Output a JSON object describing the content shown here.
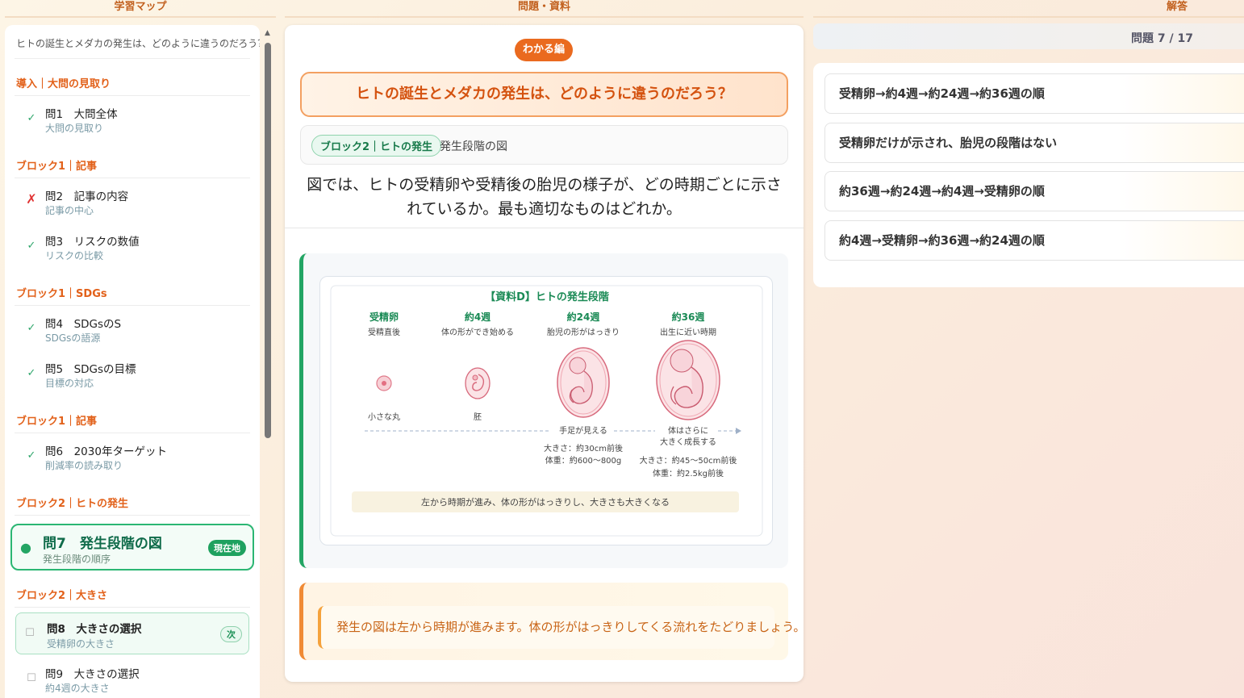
{
  "headers": {
    "map": "学習マップ",
    "problem": "問題・資料",
    "answer": "解答"
  },
  "sidebar": {
    "question": "ヒトの誕生とメダカの発生は、どのように違うのだろう？",
    "sections": [
      {
        "label": "導入｜大問の見取り",
        "items": [
          {
            "title": "問1　大問全体",
            "sub": "大問の見取り",
            "status": "✓"
          }
        ]
      },
      {
        "label": "ブロック1｜記事",
        "items": [
          {
            "title": "問2　記事の内容",
            "sub": "記事の中心",
            "status": "✗"
          },
          {
            "title": "問3　リスクの数値",
            "sub": "リスクの比較",
            "status": "✓"
          }
        ]
      },
      {
        "label": "ブロック1｜SDGs",
        "items": [
          {
            "title": "問4　SDGsのS",
            "sub": "SDGsの語源",
            "status": "✓"
          },
          {
            "title": "問5　SDGsの目標",
            "sub": "目標の対応",
            "status": "✓"
          }
        ]
      },
      {
        "label": "ブロック1｜記事",
        "items": [
          {
            "title": "問6　2030年ターゲット",
            "sub": "削減率の読み取り",
            "status": "✓"
          }
        ]
      },
      {
        "label": "ブロック2｜ヒトの発生",
        "items": [
          {
            "title": "問7　発生段階の図",
            "sub": "発生段階の順序",
            "status": "●",
            "badge": "現在地"
          }
        ]
      },
      {
        "label": "ブロック2｜大きさ",
        "items": [
          {
            "title": "問8　大きさの選択",
            "sub": "受精卵の大きさ",
            "status": "☐",
            "badge": "次"
          },
          {
            "title": "問9　大きさの選択",
            "sub": "約4週の大きさ",
            "status": "☐"
          }
        ]
      }
    ]
  },
  "main": {
    "level": "わかる編",
    "big_question": "ヒトの誕生とメダカの発生は、どのように違うのだろう？",
    "block_tag": "ブロック2｜ヒトの発生",
    "block_title": "発生段階の図",
    "question": "図では、ヒトの受精卵や受精後の胎児の様子が、どの時期ごとに示されているか。最も適切なものはどれか。",
    "figure": {
      "title": "【資料D】ヒトの発生段階",
      "stages": [
        {
          "name": "受精卵",
          "desc": "受精直後",
          "below": "小さな丸"
        },
        {
          "name": "約4週",
          "desc": "体の形ができ始める",
          "below": "胚"
        },
        {
          "name": "約24週",
          "desc": "胎児の形がはっきり",
          "below": "手足が見える"
        },
        {
          "name": "約36週",
          "desc": "出生に近い時期",
          "below": "体はさらに",
          "below2": "大きく成長する"
        }
      ],
      "size24": "大きさ：約30cm前後",
      "weight24": "体重：約600～800g",
      "size36": "大きさ：約45～50cm前後",
      "weight36": "体重：約2.5kg前後",
      "caption": "左から時期が進み、体の形がはっきりし、大きさも大きくなる"
    },
    "hint": "発生の図は左から時期が進みます。体の形がはっきりしてくる流れをたどりましょう。"
  },
  "answer": {
    "progress": "問題 7 / 17",
    "options": [
      "受精卵→約4週→約24週→約36週の順",
      "受精卵だけが示され、胎児の段階はない",
      "約36週→約24週→約4週→受精卵の順",
      "約4週→受精卵→約36週→約24週の順"
    ]
  }
}
